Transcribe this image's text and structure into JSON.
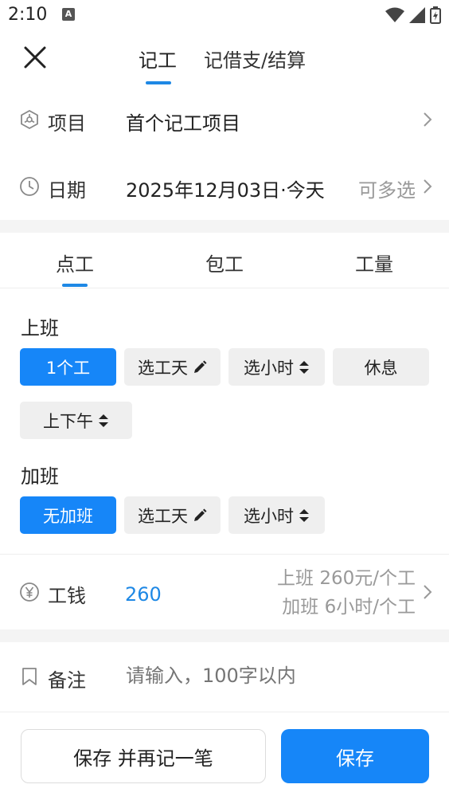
{
  "status_bar": {
    "time": "2:10",
    "notification_icon": "text-a-icon"
  },
  "top_nav": {
    "tabs": [
      {
        "label": "记工",
        "active": true
      },
      {
        "label": "记借支/结算",
        "active": false
      }
    ]
  },
  "project": {
    "label": "项目",
    "value": "首个记工项目",
    "icon": "project-icon"
  },
  "date": {
    "label": "日期",
    "value": "2025年12月03日·今天",
    "hint": "可多选",
    "icon": "clock-icon"
  },
  "sub_tabs": [
    {
      "label": "点工",
      "active": true
    },
    {
      "label": "包工",
      "active": false
    },
    {
      "label": "工量",
      "active": false
    }
  ],
  "shift": {
    "title": "上班",
    "options": [
      {
        "label": "1个工",
        "selected": true
      },
      {
        "label": "选工天",
        "icon": "pencil-icon"
      },
      {
        "label": "选小时",
        "icon": "sort-icon"
      },
      {
        "label": "休息"
      },
      {
        "label": "上下午",
        "icon": "sort-icon"
      }
    ]
  },
  "overtime": {
    "title": "加班",
    "options": [
      {
        "label": "无加班",
        "selected": true
      },
      {
        "label": "选工天",
        "icon": "pencil-icon"
      },
      {
        "label": "选小时",
        "icon": "sort-icon"
      }
    ]
  },
  "wage": {
    "label": "工钱",
    "value": "260",
    "detail_line1": "上班 260元/个工",
    "detail_line2": "加班 6小时/个工",
    "icon": "yen-icon"
  },
  "remark": {
    "label": "备注",
    "placeholder": "请输入，100字以内",
    "icon": "bookmark-icon"
  },
  "actions": {
    "save_and_new": "保存 并再记一笔",
    "save": "保存"
  },
  "colors": {
    "accent": "#1686f8",
    "indicator": "#1e88e5",
    "chip_bg": "#efefef"
  }
}
